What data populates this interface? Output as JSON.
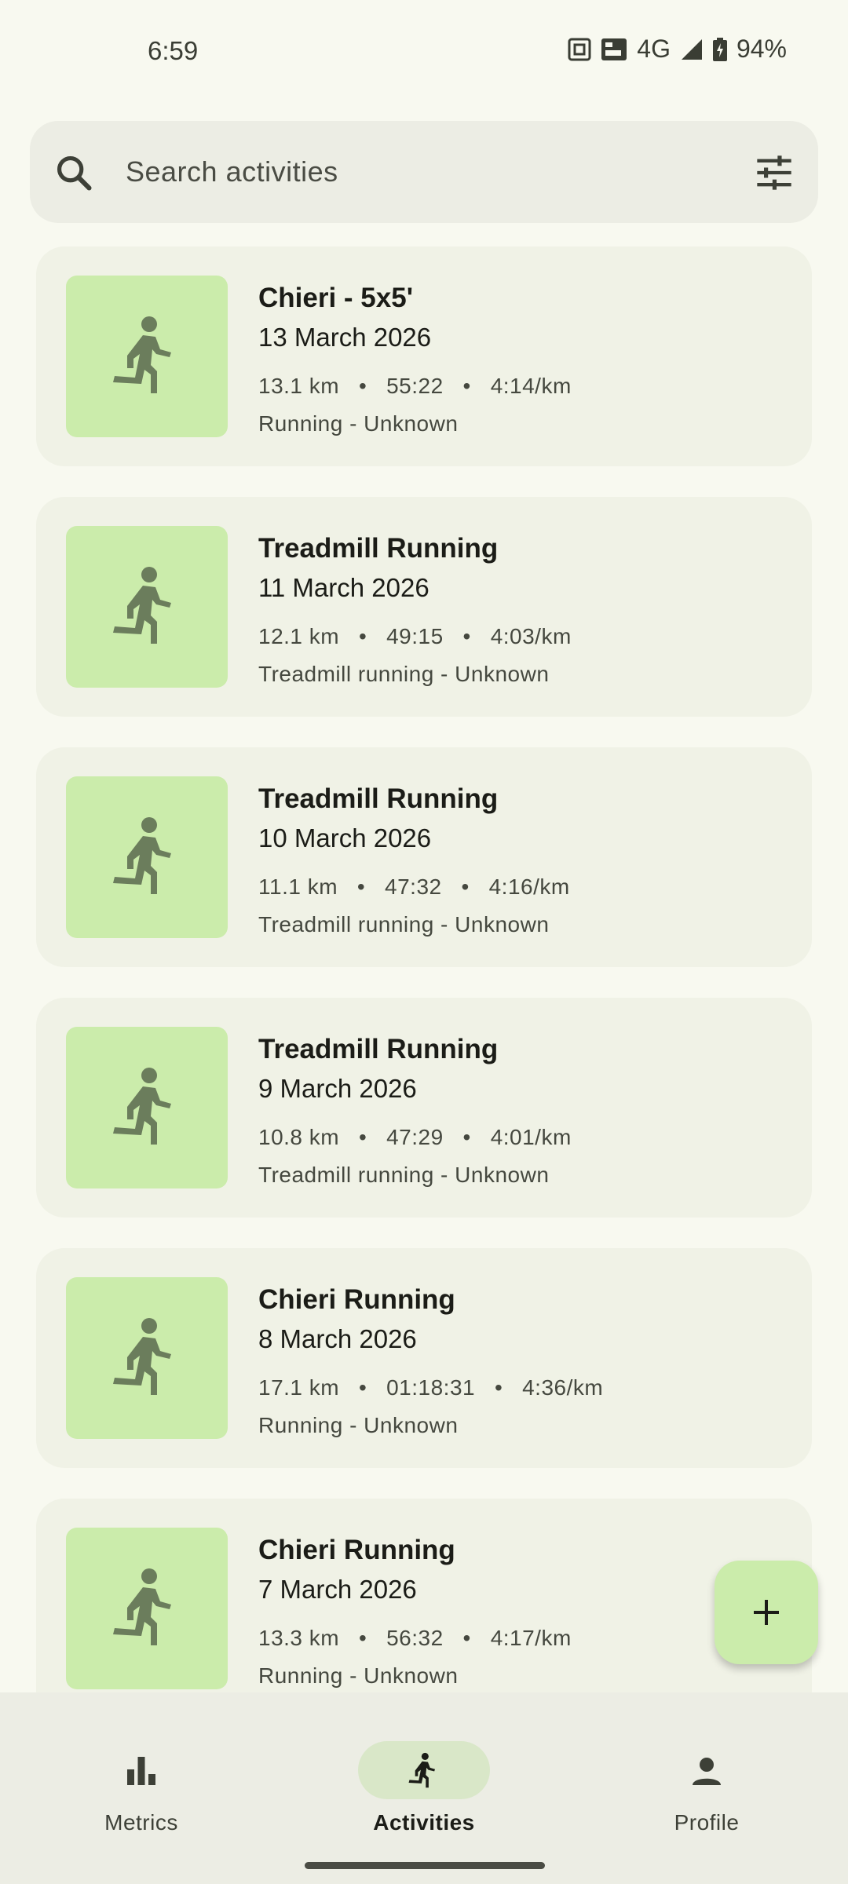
{
  "status_bar": {
    "time": "6:59",
    "network": "4G",
    "battery": "94%"
  },
  "search": {
    "placeholder": "Search activities"
  },
  "activities": [
    {
      "title": "Chieri - 5x5'",
      "date": "13 March 2026",
      "distance": "13.1 km",
      "duration": "55:22",
      "pace": "4:14/km",
      "type": "Running - Unknown"
    },
    {
      "title": "Treadmill Running",
      "date": "11 March 2026",
      "distance": "12.1 km",
      "duration": "49:15",
      "pace": "4:03/km",
      "type": "Treadmill running - Unknown"
    },
    {
      "title": "Treadmill Running",
      "date": "10 March 2026",
      "distance": "11.1 km",
      "duration": "47:32",
      "pace": "4:16/km",
      "type": "Treadmill running - Unknown"
    },
    {
      "title": "Treadmill Running",
      "date": "9 March 2026",
      "distance": "10.8 km",
      "duration": "47:29",
      "pace": "4:01/km",
      "type": "Treadmill running - Unknown"
    },
    {
      "title": "Chieri Running",
      "date": "8 March 2026",
      "distance": "17.1 km",
      "duration": "01:18:31",
      "pace": "4:36/km",
      "type": "Running - Unknown"
    },
    {
      "title": "Chieri Running",
      "date": "7 March 2026",
      "distance": "13.3 km",
      "duration": "56:32",
      "pace": "4:17/km",
      "type": "Running - Unknown"
    }
  ],
  "separator": "•",
  "nav": {
    "items": [
      {
        "label": "Metrics",
        "icon": "bar-chart-icon",
        "active": false
      },
      {
        "label": "Activities",
        "icon": "running-icon",
        "active": true
      },
      {
        "label": "Profile",
        "icon": "person-icon",
        "active": false
      }
    ]
  },
  "colors": {
    "background": "#f8f9f0",
    "card": "#f0f2e6",
    "thumb": "#cbecab",
    "active_pill": "#d9e7c8"
  }
}
